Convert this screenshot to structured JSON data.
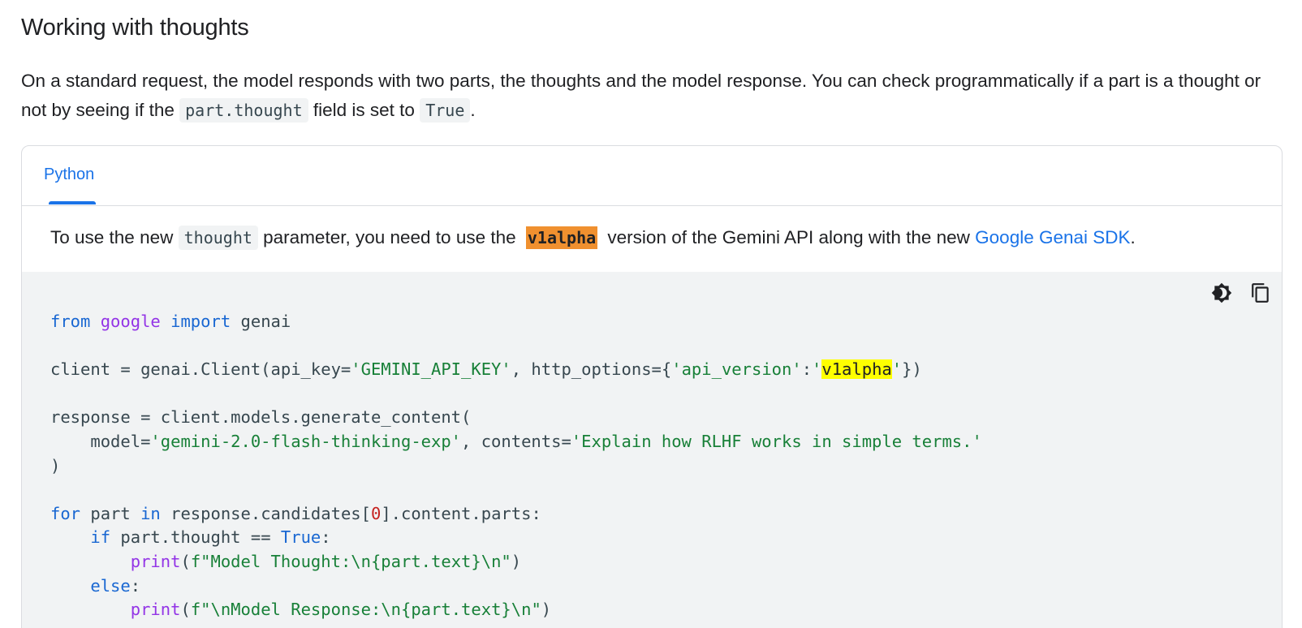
{
  "section": {
    "title": "Working with thoughts",
    "intro_part1": "On a standard request, the model responds with two parts, the thoughts and the model response. You can check programmatically if a part is a thought or not by seeing if the ",
    "intro_code1": "part.thought",
    "intro_part2": " field is set to ",
    "intro_code2": "True",
    "intro_part3": "."
  },
  "tabs": [
    {
      "label": "Python",
      "active": true
    }
  ],
  "note": {
    "part1": "To use the new ",
    "code1": "thought",
    "part2": " parameter, you need to use the ",
    "highlight": "v1alpha",
    "part3": " version of the Gemini API along with the new ",
    "link": "Google Genai SDK",
    "part4": "."
  },
  "code_tools": [
    {
      "icon": "dark-mode-icon"
    },
    {
      "icon": "copy-icon"
    }
  ],
  "code": {
    "language": "python",
    "lines": [
      "from google import genai",
      "",
      "client = genai.Client(api_key='GEMINI_API_KEY', http_options={'api_version':'v1alpha'})",
      "",
      "response = client.models.generate_content(",
      "    model='gemini-2.0-flash-thinking-exp', contents='Explain how RLHF works in simple terms.'",
      ")",
      "",
      "for part in response.candidates[0].content.parts:",
      "    if part.thought == True:",
      "        print(f\"Model Thought:\\n{part.text}\\n\")",
      "    else:",
      "        print(f\"\\nModel Response:\\n{part.text}\\n\")"
    ]
  },
  "colors": {
    "link": "#1a73e8",
    "keyword": "#1967d2",
    "module": "#9334e6",
    "string": "#188038",
    "number": "#c5221f",
    "highlight_orange": "#f0902f",
    "highlight_yellow": "#ffff00"
  }
}
